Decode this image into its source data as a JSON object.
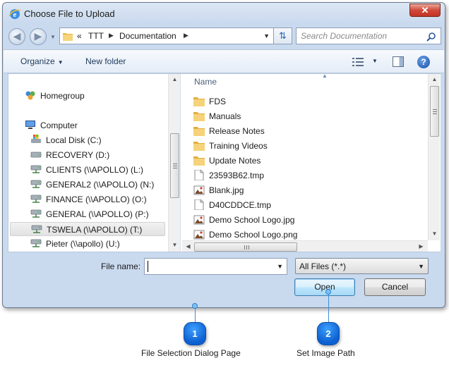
{
  "window": {
    "title": "Choose File to Upload",
    "close_label": "✕"
  },
  "address": {
    "crumbs": [
      "«",
      "TTT",
      "Documentation"
    ],
    "search_placeholder": "Search Documentation"
  },
  "toolbar": {
    "organize_label": "Organize",
    "new_folder_label": "New folder"
  },
  "nav": {
    "homegroup": "Homegroup",
    "computer": "Computer",
    "drives": [
      "Local Disk (C:)",
      "RECOVERY (D:)",
      "CLIENTS (\\\\APOLLO) (L:)",
      "GENERAL2 (\\\\APOLLO) (N:)",
      "FINANCE (\\\\APOLLO) (O:)",
      "GENERAL (\\\\APOLLO) (P:)",
      "TSWELA (\\\\APOLLO) (T:)",
      "Pieter (\\\\apollo) (U:)"
    ]
  },
  "files": {
    "column_name": "Name",
    "items": [
      {
        "name": "FDS",
        "icon": "folder-icon"
      },
      {
        "name": "Manuals",
        "icon": "folder-icon"
      },
      {
        "name": "Release Notes",
        "icon": "folder-icon"
      },
      {
        "name": "Training Videos",
        "icon": "folder-icon"
      },
      {
        "name": "Update Notes",
        "icon": "folder-icon"
      },
      {
        "name": "23593B62.tmp",
        "icon": "file-icon"
      },
      {
        "name": "Blank.jpg",
        "icon": "image-icon"
      },
      {
        "name": "D40CDDCE.tmp",
        "icon": "file-icon"
      },
      {
        "name": "Demo School Logo.jpg",
        "icon": "image-icon"
      },
      {
        "name": "Demo School Logo.png",
        "icon": "image-icon"
      }
    ]
  },
  "footer": {
    "file_name_label": "File name:",
    "file_name_value": "",
    "filter_value": "All Files (*.*)",
    "open_label": "Open",
    "cancel_label": "Cancel"
  },
  "callouts": [
    {
      "number": "1",
      "label": "File Selection Dialog Page"
    },
    {
      "number": "2",
      "label": "Set Image Path"
    }
  ]
}
